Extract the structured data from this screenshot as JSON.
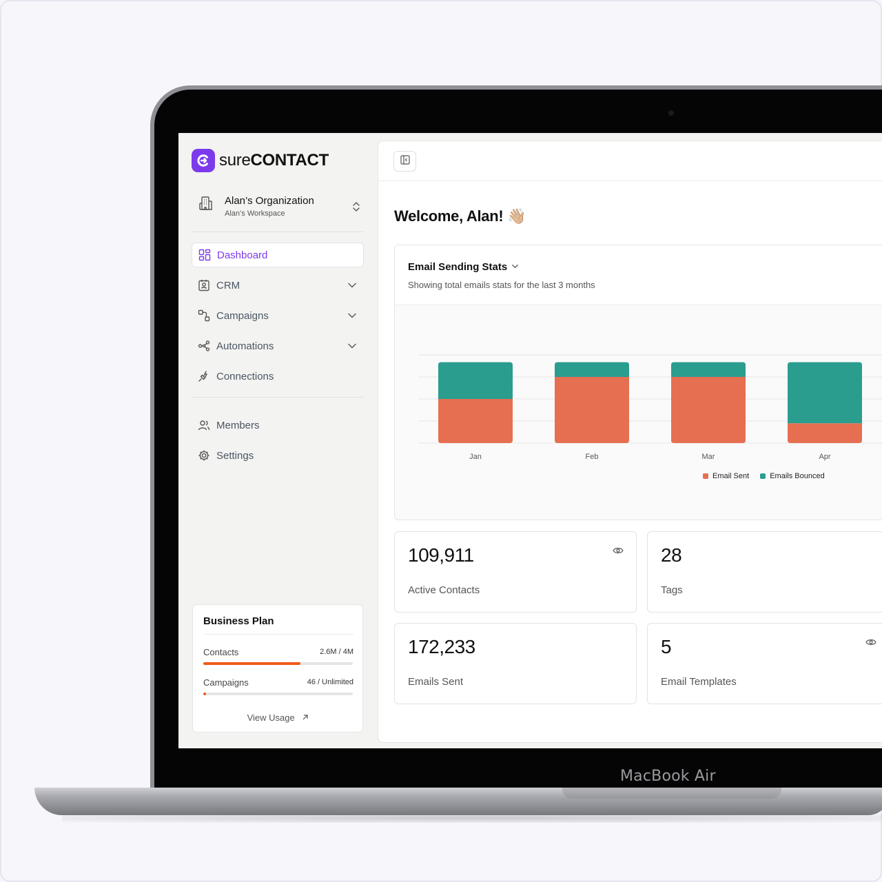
{
  "brand": {
    "logo_light": "sure",
    "logo_bold": "CONTACT",
    "accent": "#7c3aed"
  },
  "device": {
    "label": "MacBook Air"
  },
  "organization": {
    "name": "Alan’s Organization",
    "workspace": "Alan’s Workspace",
    "icon": "building-icon"
  },
  "sidebar": {
    "items": [
      {
        "label": "Dashboard",
        "icon": "dashboard-grid-icon",
        "active": true
      },
      {
        "label": "CRM",
        "icon": "contact-card-icon",
        "expandable": true
      },
      {
        "label": "Campaigns",
        "icon": "campaigns-icon",
        "expandable": true
      },
      {
        "label": "Automations",
        "icon": "automations-icon",
        "expandable": true
      },
      {
        "label": "Connections",
        "icon": "plug-icon"
      },
      {
        "label": "Members",
        "icon": "users-icon"
      },
      {
        "label": "Settings",
        "icon": "gear-icon"
      }
    ]
  },
  "plan": {
    "title": "Business Plan",
    "contacts_label": "Contacts",
    "contacts_value": "2.6M / 4M",
    "contacts_fraction": 0.65,
    "campaigns_label": "Campaigns",
    "campaigns_value": "46 / Unlimited",
    "campaigns_fraction": 0.02,
    "view_usage": "View Usage",
    "bar_color": "#f05a1a"
  },
  "main": {
    "welcome": "Welcome, Alan!",
    "wave": "👋🏼"
  },
  "stats": {
    "title": "Email Sending Stats",
    "subtitle": "Showing total emails stats for the last 3 months",
    "legend_sent": "Email Sent",
    "legend_bounced": "Emails Bounced"
  },
  "chart_data": {
    "type": "bar",
    "stacked": true,
    "categories": [
      "Jan",
      "Feb",
      "Mar",
      "Apr"
    ],
    "series": [
      {
        "name": "Email Sent",
        "color": "#e76f51",
        "values": [
          60,
          90,
          90,
          27
        ]
      },
      {
        "name": "Emails Bounced",
        "color": "#2a9d8f",
        "values": [
          50,
          20,
          20,
          83
        ]
      }
    ],
    "ylim": [
      0,
      120
    ],
    "grid": true,
    "legend": "bottom-right"
  },
  "cards": [
    {
      "value": "109,911",
      "label": "Active Contacts",
      "eye": true
    },
    {
      "value": "28",
      "label": "Tags",
      "eye": false
    },
    {
      "value": "172,233",
      "label": "Emails Sent",
      "eye": false
    },
    {
      "value": "5",
      "label": "Email Templates",
      "eye": true
    }
  ]
}
